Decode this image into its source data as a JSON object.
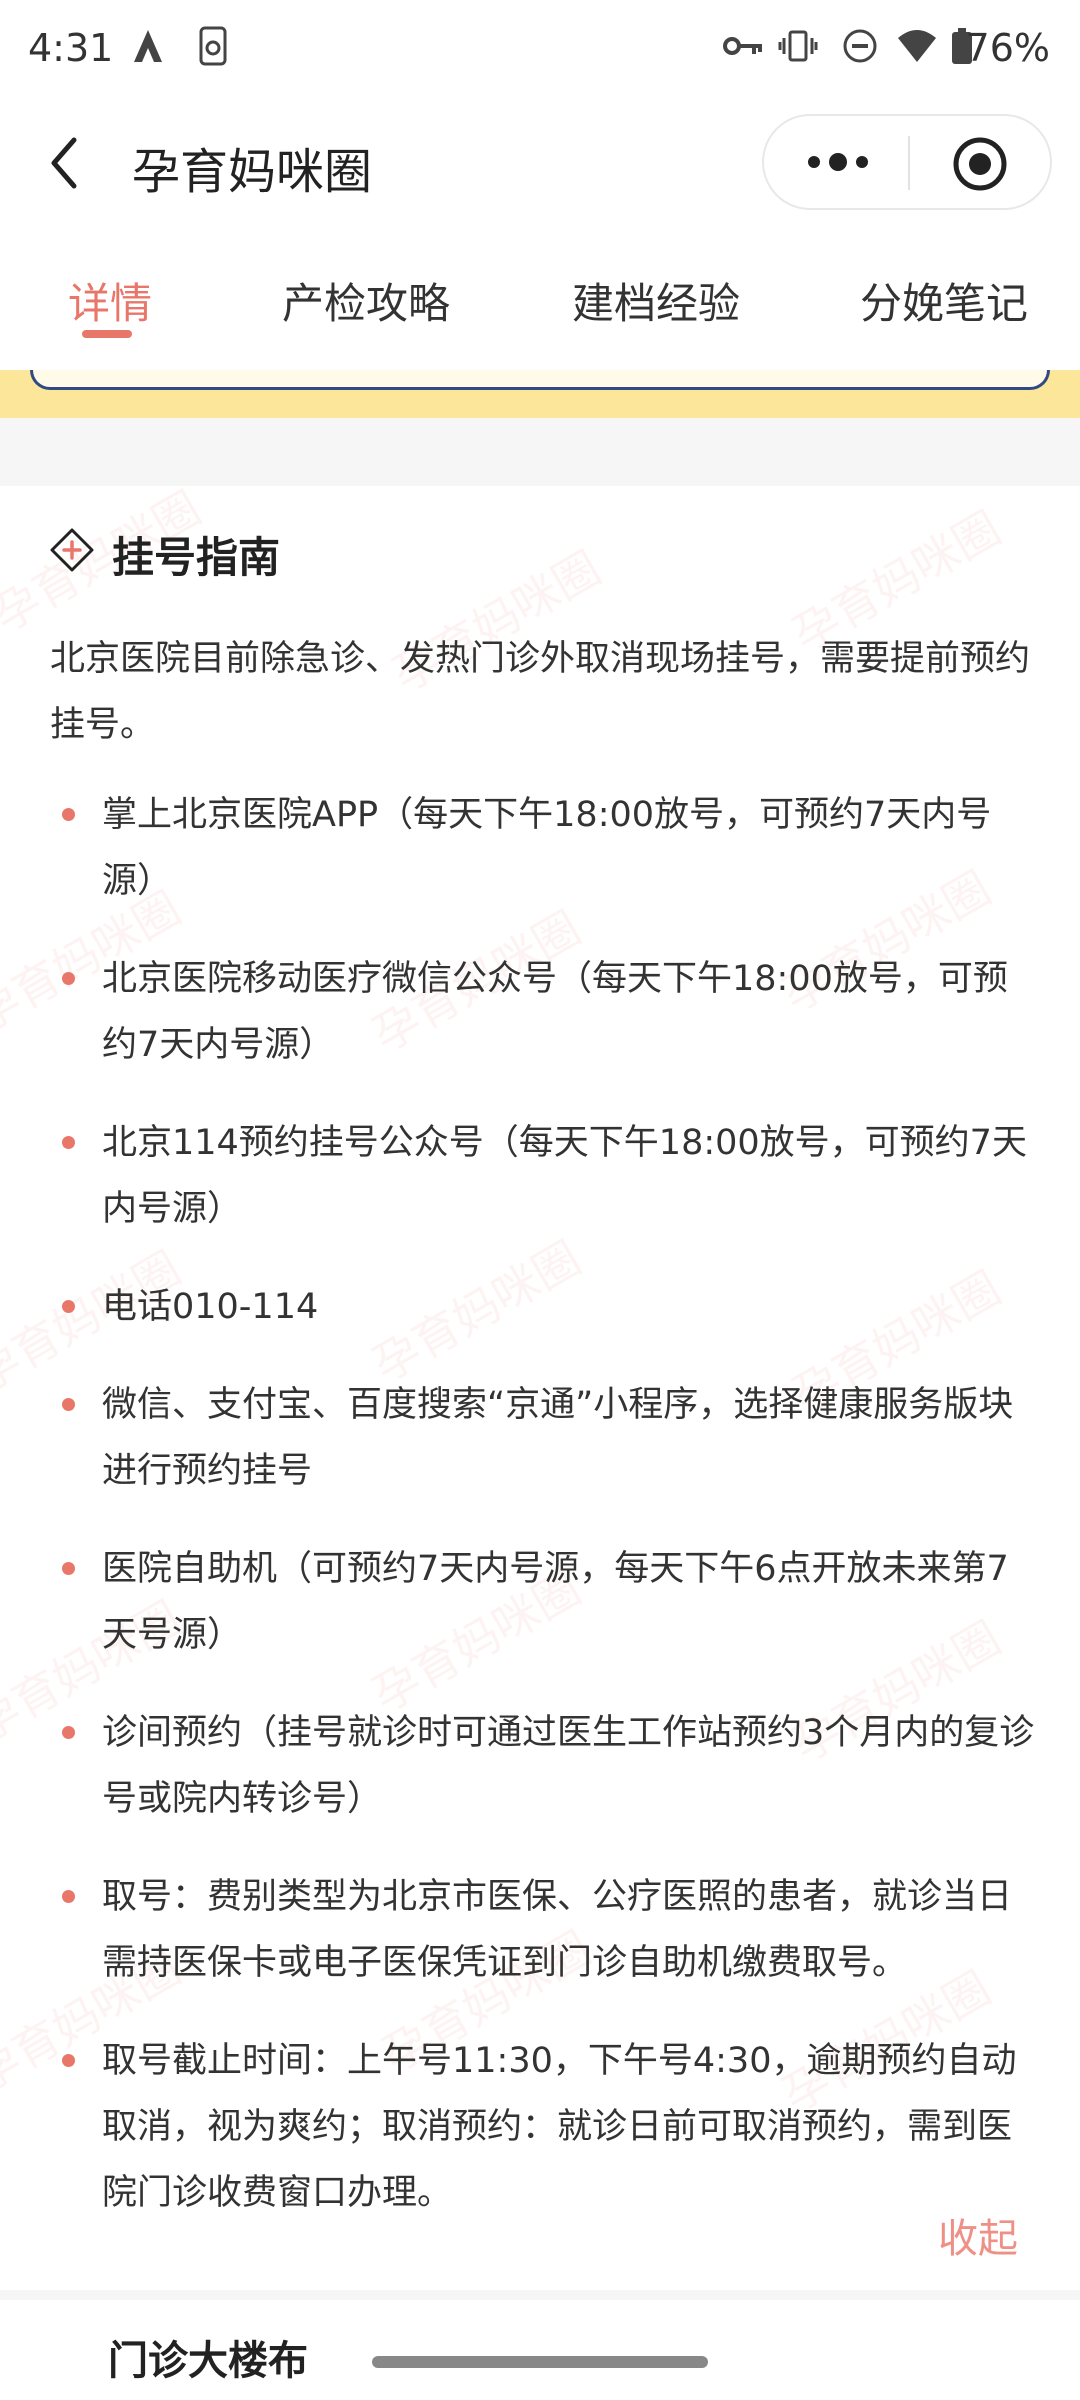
{
  "status_bar": {
    "time": "4:31",
    "battery": "76%",
    "icons": [
      "a-icon",
      "phone-sync-icon",
      "key-icon",
      "vibrate-icon",
      "dnd-icon",
      "wifi-icon",
      "battery-icon"
    ]
  },
  "header": {
    "title": "孕育妈咪圈",
    "back_icon": "back-icon",
    "more_icon": "more-icon",
    "close_icon": "close-target-icon"
  },
  "tabs": [
    {
      "label": "详情",
      "active": true
    },
    {
      "label": "产检攻略",
      "active": false
    },
    {
      "label": "建档经验",
      "active": false
    },
    {
      "label": "分娩笔记",
      "active": false
    }
  ],
  "section": {
    "title": "挂号指南",
    "icon": "plus-diamond-icon",
    "intro": "北京医院目前除急诊、发热门诊外取消现场挂号，需要提前预约挂号。",
    "items": [
      "掌上北京医院APP（每天下午18:00放号，可预约7天内号源）",
      "北京医院移动医疗微信公众号（每天下午18:00放号，可预约7天内号源）",
      "北京114预约挂号公众号（每天下午18:00放号，可预约7天内号源）",
      "电话010-114",
      "微信、支付宝、百度搜索“京通”小程序，选择健康服务版块进行预约挂号",
      "医院自助机（可预约7天内号源，每天下午6点开放未来第7天号源）",
      "诊间预约（挂号就诊时可通过医生工作站预约3个月内的复诊号或院内转诊号）",
      "取号：费别类型为北京市医保、公疗医照的患者，就诊当日需持医保卡或电子医保凭证到门诊自助机缴费取号。",
      "取号截止时间：上午号11:30，下午号4:30，逾期预约自动取消，视为爽约；取消预约：就诊日前可取消预约，需到医院门诊收费窗口办理。"
    ],
    "collapse_label": "收起",
    "watermark_text": "孕育妈咪圈"
  },
  "next_section": {
    "title": "门诊大楼布"
  },
  "colors": {
    "accent": "#e8776a",
    "yellow": "#fbe69a",
    "navy": "#2f4a85"
  }
}
